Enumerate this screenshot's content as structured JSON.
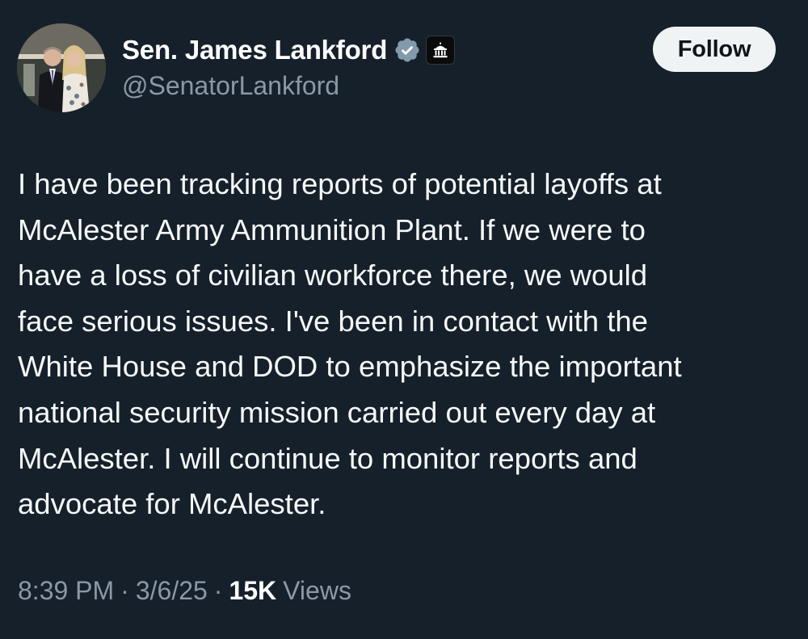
{
  "author": {
    "display_name": "Sen. James Lankford",
    "handle": "@SenatorLankford",
    "verified_icon": "verified-badge-icon",
    "affiliation_icon": "government-building-icon",
    "avatar": "profile-photo"
  },
  "follow_button": {
    "label": "Follow"
  },
  "tweet": {
    "lines": [
      "I have been tracking reports of potential layoffs at",
      "McAlester Army Ammunition Plant. If we were to",
      "have a loss of civilian workforce there, we would",
      "face serious issues. I've been in contact with the",
      "White House and DOD to emphasize the important",
      "national security mission carried out every day at",
      "McAlester. I will continue to monitor reports and",
      "advocate for McAlester."
    ]
  },
  "meta": {
    "time": "8:39 PM",
    "separator": "·",
    "date": "3/6/25",
    "views_count": "15K",
    "views_label": "Views"
  },
  "colors": {
    "background": "#15202b",
    "primary_text": "#f7f9f9",
    "secondary_text": "#8b98a5",
    "verified_badge": "#829aab",
    "follow_button_bg": "#eff3f4"
  }
}
